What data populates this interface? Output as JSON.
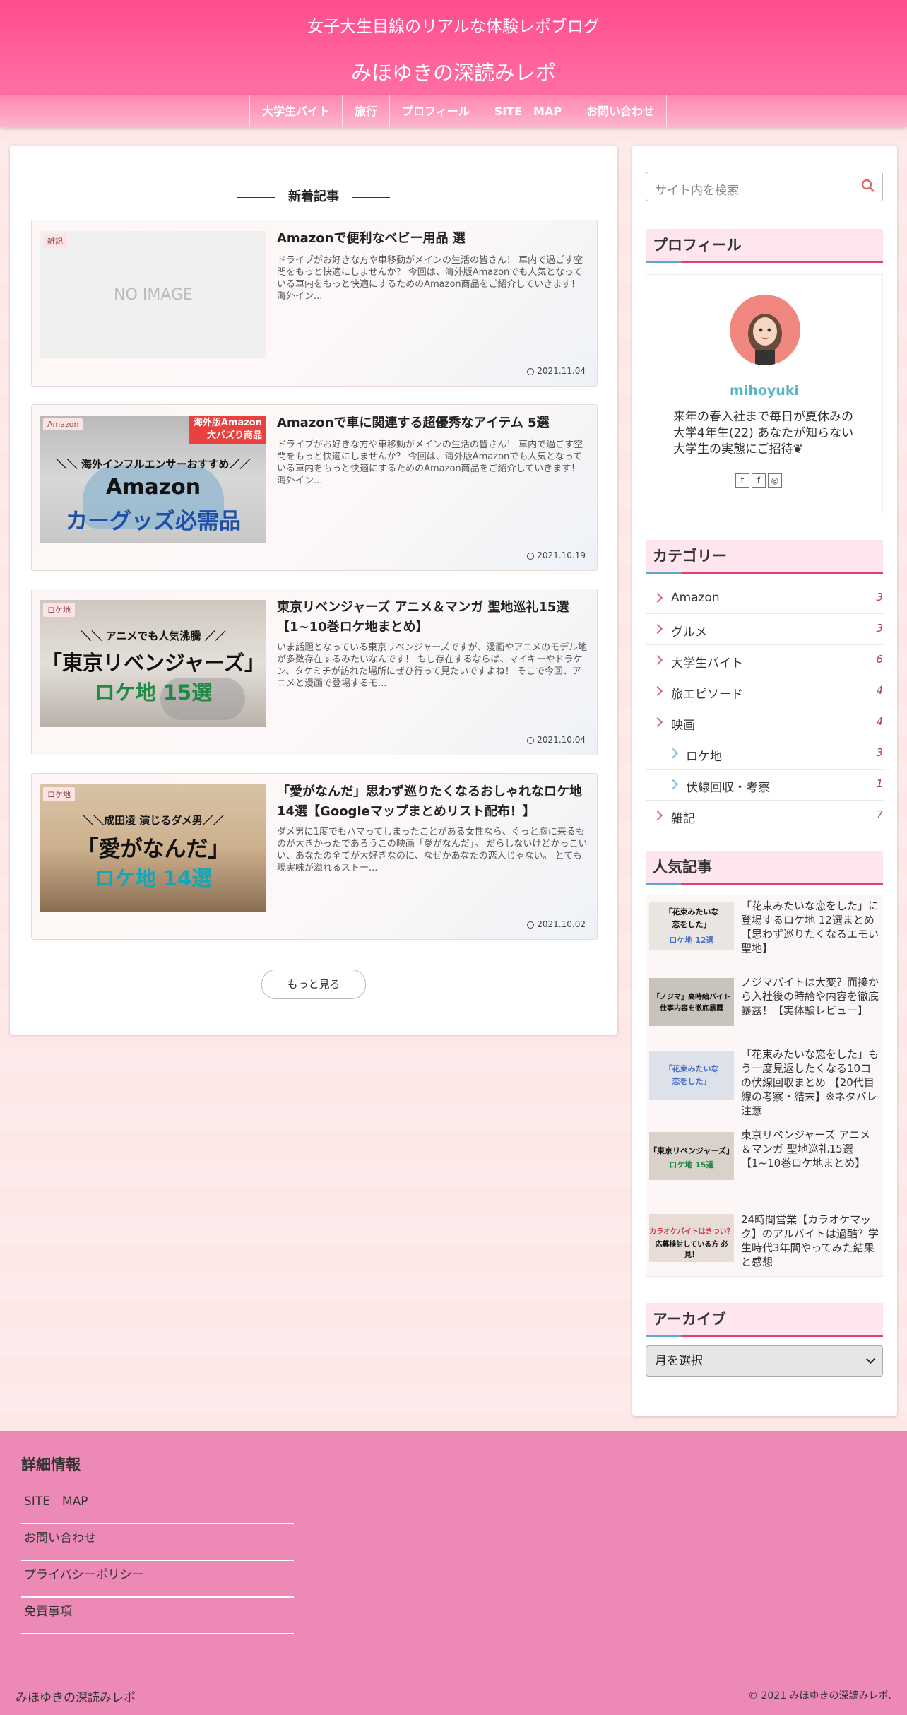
{
  "header": {
    "tagline": "女子大生目線のリアルな体験レポブログ",
    "site_name": "みほゆきの深読みレポ"
  },
  "nav": [
    {
      "label": "大学生バイト"
    },
    {
      "label": "旅行"
    },
    {
      "label": "プロフィール"
    },
    {
      "label": "SITE　MAP"
    },
    {
      "label": "お問い合わせ"
    }
  ],
  "main": {
    "section_title": "新着記事",
    "more_label": "もっと見る",
    "articles": [
      {
        "category": "雑記",
        "thumb_text": "NO IMAGE",
        "title": "Amazonで便利なベビー用品 選",
        "snippet": "ドライブがお好きな方や車移動がメインの生活の皆さん！ 車内で過ごす空間をもっと快適にしませんか？ 今回は、海外版Amazonでも人気となっている車内をもっと快適にするためのAmazon商品をご紹介していきます！ 海外イン...",
        "date": "2021.11.04"
      },
      {
        "category": "Amazon",
        "thumb_lines": [
          "海外版Amazon",
          "大バズり商品",
          "＼＼ 海外インフルエンサーおすすめ／／",
          "Amazon",
          "カーグッズ必需品"
        ],
        "title": "Amazonで車に関連する超優秀なアイテム 5選",
        "snippet": "ドライブがお好きな方や車移動がメインの生活の皆さん！ 車内で過ごす空間をもっと快適にしませんか？ 今回は、海外版Amazonでも人気となっている車内をもっと快適にするためのAmazon商品をご紹介していきます！ 海外イン...",
        "date": "2021.10.19"
      },
      {
        "category": "ロケ地",
        "thumb_lines": [
          "＼＼ アニメでも人気沸騰 ／／",
          "「東京リベンジャーズ」",
          "ロケ地 15選"
        ],
        "title": "東京リベンジャーズ アニメ＆マンガ 聖地巡礼15選【1~10巻ロケ地まとめ】",
        "snippet": "いま話題となっている東京リベンジャーズですが、漫画やアニメのモデル地が多数存在するみたいなんです！ もし存在するならば、マイキーやドラケン、タケミチが訪れた場所にぜひ行って見たいですよね！ そこで今回、アニメと漫画で登場するモ...",
        "date": "2021.10.04"
      },
      {
        "category": "ロケ地",
        "thumb_lines": [
          "＼＼成田凌 演じるダメ男／／",
          "「愛がなんだ」",
          "ロケ地 14選"
        ],
        "title": "「愛がなんだ」思わず巡りたくなるおしゃれなロケ地14選【Googleマップまとめリスト配布！】",
        "snippet": "ダメ男に1度でもハマってしまったことがある女性なら、ぐっと胸に来るものが大きかったであろうこの映画「愛がなんだ」。 だらしないけどかっこいい、あなたの全てが大好きなのに、なぜかあなたの恋人じゃない。 とても現実味が溢れるストー...",
        "date": "2021.10.02"
      }
    ]
  },
  "sidebar": {
    "search_placeholder": "サイト内を検索",
    "profile": {
      "title": "プロフィール",
      "name": "mihoyuki",
      "description": "来年の春入社まで毎日が夏休みの大学4年生(22) あなたが知らない大学生の実態にご招待❦",
      "social": [
        "twitter-icon",
        "facebook-icon",
        "instagram-icon"
      ]
    },
    "categories": {
      "title": "カテゴリー",
      "items": [
        {
          "label": "Amazon",
          "count": "3",
          "sub": false
        },
        {
          "label": "グルメ",
          "count": "3",
          "sub": false
        },
        {
          "label": "大学生バイト",
          "count": "6",
          "sub": false
        },
        {
          "label": "旅エピソード",
          "count": "4",
          "sub": false
        },
        {
          "label": "映画",
          "count": "4",
          "sub": false
        },
        {
          "label": "ロケ地",
          "count": "3",
          "sub": true
        },
        {
          "label": "伏線回収・考察",
          "count": "1",
          "sub": true
        },
        {
          "label": "雑記",
          "count": "7",
          "sub": false
        }
      ]
    },
    "popular": {
      "title": "人気記事",
      "items": [
        {
          "title": "「花束みたいな恋をした」に登場するロケ地 12選まとめ【思わず巡りたくなるエモい聖地】",
          "thumb_lines": [
            "「花束みたいな",
            "恋をした」",
            "ロケ地 12選"
          ]
        },
        {
          "title": "ノジマバイトは大変？面接から入社後の時給や内容を徹底暴露！【実体験レビュー】",
          "thumb_lines": [
            "「ノジマ」高時給バイト",
            "仕事内容を徹底暴露"
          ]
        },
        {
          "title": "「花束みたいな恋をした」もう一度見返したくなる10コの伏線回収まとめ 【20代目線の考察・結末】※ネタバレ注意",
          "thumb_lines": [
            "「花束みたいな",
            "恋をした」"
          ]
        },
        {
          "title": "東京リベンジャーズ アニメ＆マンガ 聖地巡礼15選【1~10巻ロケ地まとめ】",
          "thumb_lines": [
            "「東京リベンジャーズ」",
            "ロケ地 15選"
          ]
        },
        {
          "title": "24時間営業【カラオケマック】のアルバイトは過酷？学生時代3年間やってみた結果と感想",
          "thumb_lines": [
            "カラオケバイトはきつい？",
            "応募検討している方 必見！"
          ]
        }
      ]
    },
    "archive": {
      "title": "アーカイブ",
      "select_value": "月を選択"
    }
  },
  "footer": {
    "title": "詳細情報",
    "links": [
      "SITE　MAP",
      "お問い合わせ",
      "プライバシーポリシー",
      "免責事項"
    ],
    "site_name": "みほゆきの深読みレポ",
    "copyright": "© 2021 みほゆきの深読みレポ."
  },
  "colors": {
    "header_pink": "#ff4d8d",
    "footer_pink": "#ec89b7",
    "accent_red": "#e0436f",
    "accent_blue": "#5fa7d4"
  }
}
